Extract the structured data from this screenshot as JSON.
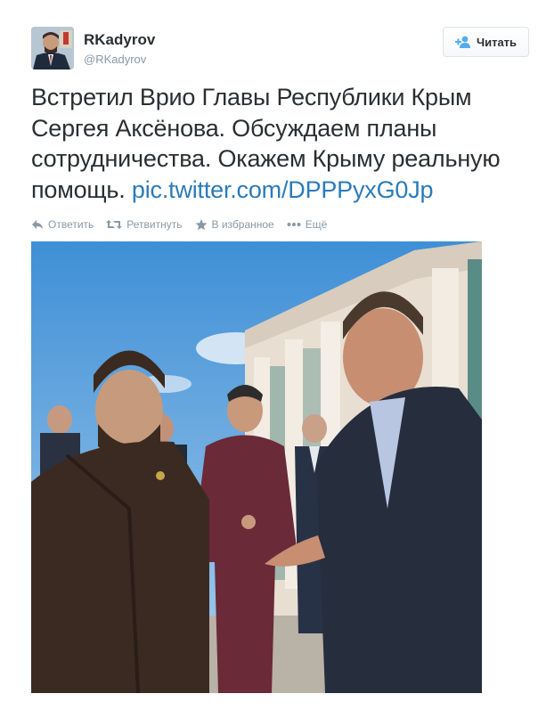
{
  "user": {
    "name": "RKadyrov",
    "handle": "@RKadyrov",
    "avatar_icon": "profile-photo"
  },
  "follow_button": {
    "label": "Читать",
    "icon": "add-user-icon",
    "color": "#55acee"
  },
  "tweet": {
    "text": "Встретил Врио Главы Республики Крым Сергея Аксёнова. Обсуждаем планы сотрудничества. Окажем Крыму реальную помощь.",
    "link": "pic.twitter.com/DPPPyxG0Jp",
    "link_color": "#2b7bb9"
  },
  "actions": [
    {
      "icon": "reply-icon",
      "label": "Ответить"
    },
    {
      "icon": "retweet-icon",
      "label": "Ретвитнуть"
    },
    {
      "icon": "star-icon",
      "label": "В избранное"
    },
    {
      "icon": "more-dots-icon",
      "label": "Ещё"
    }
  ],
  "photo": {
    "description_icon": "attached-photo"
  }
}
